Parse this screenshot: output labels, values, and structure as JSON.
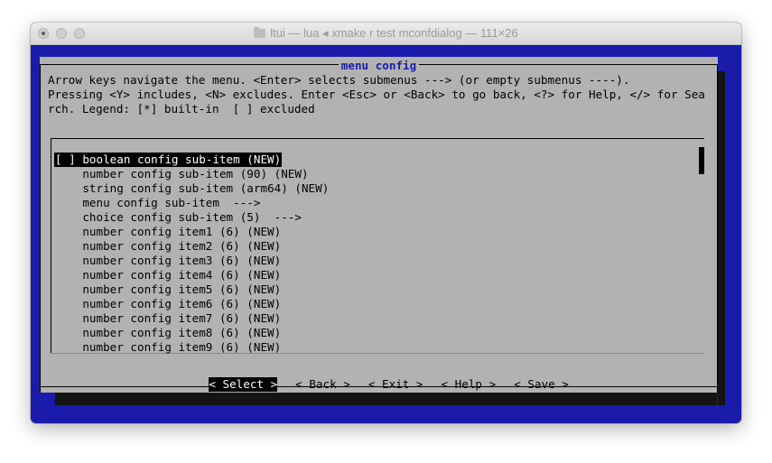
{
  "window": {
    "title": "ltui — lua ◂ xmake r test mconfdialog — 111×26"
  },
  "dialog": {
    "title": "menu config",
    "help_text": "Arrow keys navigate the menu. <Enter> selects submenus ---> (or empty submenus ----).\nPressing <Y> includes, <N> excludes. Enter <Esc> or <Back> to go back, <?> for Help, </> for Search. Legend: [*] built-in  [ ] excluded",
    "menu_items": [
      "[ ] boolean config sub-item (NEW)",
      "    number config sub-item (90) (NEW)",
      "    string config sub-item (arm64) (NEW)",
      "    menu config sub-item  --->",
      "    choice config sub-item (5)  --->",
      "    number config item1 (6) (NEW)",
      "    number config item2 (6) (NEW)",
      "    number config item3 (6) (NEW)",
      "    number config item4 (6) (NEW)",
      "    number config item5 (6) (NEW)",
      "    number config item6 (6) (NEW)",
      "    number config item7 (6) (NEW)",
      "    number config item8 (6) (NEW)",
      "    number config item9 (6) (NEW)"
    ],
    "buttons": {
      "select": "< Select >",
      "back": "< Back >",
      "exit": "< Exit >",
      "help": "< Help >",
      "save": "< Save >"
    }
  },
  "colors": {
    "terminal_bg": "#1b1bab",
    "dialog_bg": "#b2b2b2",
    "title_color": "#1c1ca8",
    "selection_bg": "#000000",
    "selection_fg": "#ffffff"
  }
}
